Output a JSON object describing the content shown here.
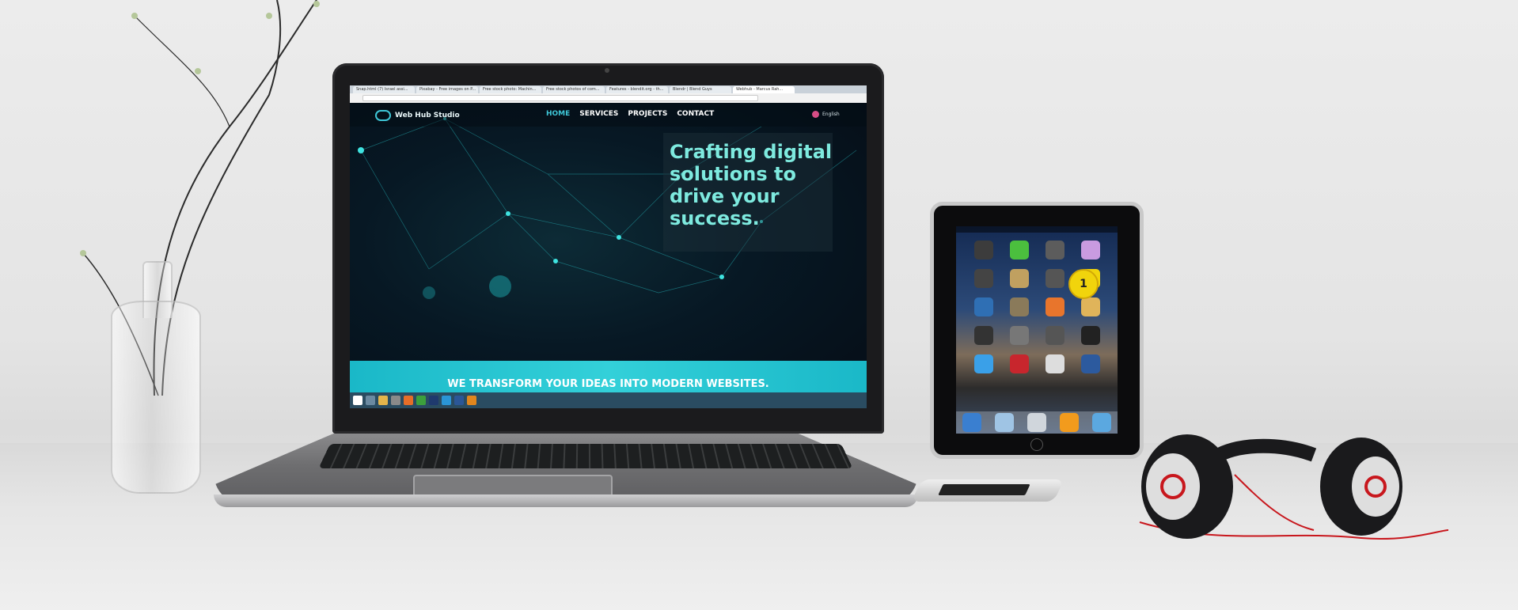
{
  "browser": {
    "tabs": [
      "Snap.html (7) Israel assi...",
      "Pixabay - Free images on P...",
      "Free stock photo: Machin...",
      "Free stock photos of com...",
      "Features - blendit.org - th...",
      "Blendr | Blend Guys",
      "Webhub - Marcus Rah..."
    ],
    "active_tab_index": 6
  },
  "site": {
    "brand": "Web Hub Studio",
    "menu": [
      "HOME",
      "SERVICES",
      "PROJECTS",
      "CONTACT"
    ],
    "active_menu_index": 0,
    "language": "English",
    "headline": "Crafting digital solutions to drive your success.",
    "banner": "WE TRANSFORM YOUR IDEAS INTO MODERN WEBSITES.",
    "accent_color": "#3ec6d6",
    "headline_color": "#7eeadf"
  },
  "tablet": {
    "badge_number": "1",
    "apps": [
      {
        "color": "#3c3c3c"
      },
      {
        "color": "#4bbf3e"
      },
      {
        "color": "#5c5c5c"
      },
      {
        "color": "#c99be0"
      },
      {
        "color": "#444"
      },
      {
        "color": "#c0a060"
      },
      {
        "color": "#555"
      },
      {
        "color": "#f1d40c"
      },
      {
        "color": "#2f6fb4"
      },
      {
        "color": "#8a7a5a"
      },
      {
        "color": "#e8752c"
      },
      {
        "color": "#e0b45a"
      },
      {
        "color": "#333"
      },
      {
        "color": "#777"
      },
      {
        "color": "#555"
      },
      {
        "color": "#222"
      },
      {
        "color": "#3aa0e8"
      },
      {
        "color": "#c8262d"
      },
      {
        "color": "#ddd"
      },
      {
        "color": "#2c5a9e"
      }
    ],
    "dock_colors": [
      "#3a7fd0",
      "#9fc4e4",
      "#d0d6dc",
      "#f29b1d",
      "#5ba8e0"
    ]
  },
  "headphones_color": "#1a1a1c",
  "cable_color": "#c8171d"
}
